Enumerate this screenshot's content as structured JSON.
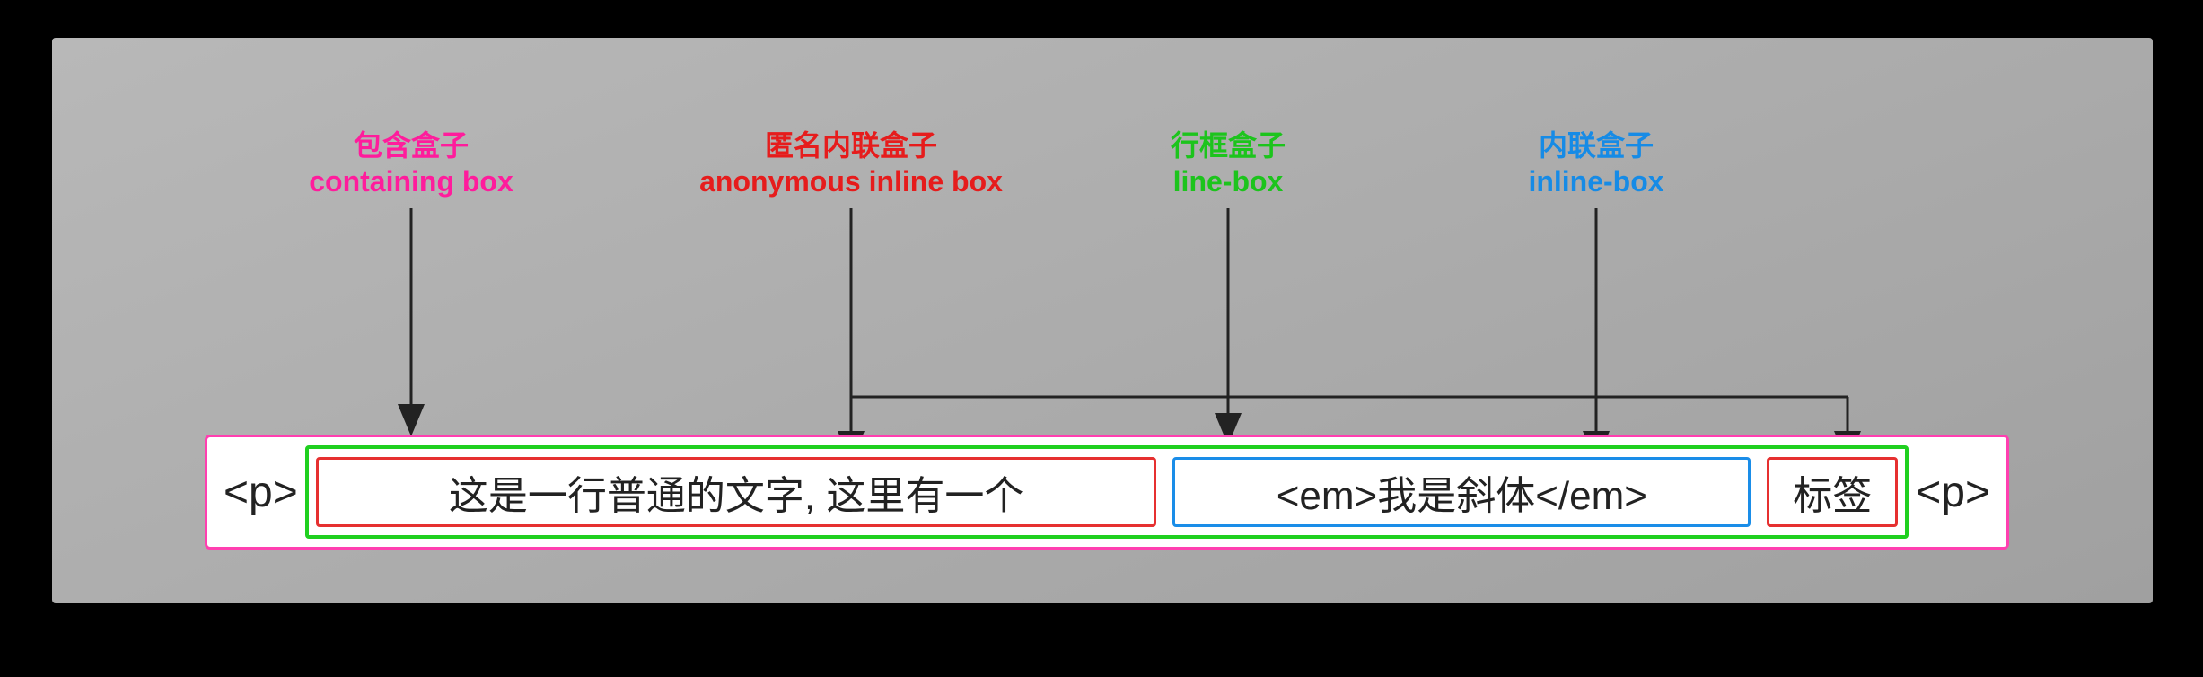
{
  "labels": {
    "containing": {
      "cn": "包含盒子",
      "en": "containing box"
    },
    "anonymous": {
      "cn": "匿名内联盒子",
      "en": "anonymous inline box"
    },
    "linebox": {
      "cn": "行框盒子",
      "en": "line-box"
    },
    "inlinebox": {
      "cn": "内联盒子",
      "en": "inline-box"
    }
  },
  "tags": {
    "open": "<p>",
    "close": "<p>"
  },
  "content": {
    "anon1": "这是一行普通的文字, 这里有一个",
    "inline": "<em>我是斜体</em>",
    "anon2": "标签"
  },
  "colors": {
    "containing": "#ff3fb0",
    "anonymous": "#e63030",
    "linebox": "#20d020",
    "inlinebox": "#1a8de8",
    "arrow": "#222222"
  }
}
